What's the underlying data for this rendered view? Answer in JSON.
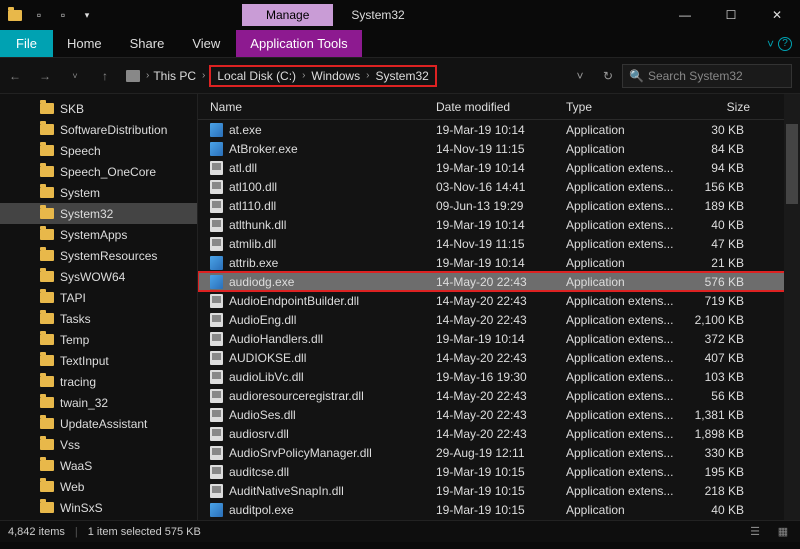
{
  "titlebar": {
    "manage_label": "Manage",
    "title": "System32"
  },
  "ribbon": {
    "file": "File",
    "home": "Home",
    "share": "Share",
    "view": "View",
    "app_tools": "Application Tools"
  },
  "breadcrumb": {
    "thispc": "This PC",
    "localdisk": "Local Disk (C:)",
    "windows": "Windows",
    "system32": "System32"
  },
  "search": {
    "placeholder": "Search System32"
  },
  "tree": {
    "items": [
      {
        "label": "SKB"
      },
      {
        "label": "SoftwareDistribution"
      },
      {
        "label": "Speech"
      },
      {
        "label": "Speech_OneCore"
      },
      {
        "label": "System"
      },
      {
        "label": "System32",
        "sel": true
      },
      {
        "label": "SystemApps"
      },
      {
        "label": "SystemResources"
      },
      {
        "label": "SysWOW64"
      },
      {
        "label": "TAPI"
      },
      {
        "label": "Tasks"
      },
      {
        "label": "Temp"
      },
      {
        "label": "TextInput"
      },
      {
        "label": "tracing"
      },
      {
        "label": "twain_32"
      },
      {
        "label": "UpdateAssistant"
      },
      {
        "label": "Vss"
      },
      {
        "label": "WaaS"
      },
      {
        "label": "Web"
      },
      {
        "label": "WinSxS"
      }
    ]
  },
  "columns": {
    "name": "Name",
    "date": "Date modified",
    "type": "Type",
    "size": "Size"
  },
  "files": [
    {
      "name": "at.exe",
      "date": "19-Mar-19 10:14",
      "type": "Application",
      "size": "30 KB",
      "ic": "exe"
    },
    {
      "name": "AtBroker.exe",
      "date": "14-Nov-19 11:15",
      "type": "Application",
      "size": "84 KB",
      "ic": "exe"
    },
    {
      "name": "atl.dll",
      "date": "19-Mar-19 10:14",
      "type": "Application extens...",
      "size": "94 KB",
      "ic": "dll"
    },
    {
      "name": "atl100.dll",
      "date": "03-Nov-16 14:41",
      "type": "Application extens...",
      "size": "156 KB",
      "ic": "dll"
    },
    {
      "name": "atl110.dll",
      "date": "09-Jun-13 19:29",
      "type": "Application extens...",
      "size": "189 KB",
      "ic": "dll"
    },
    {
      "name": "atlthunk.dll",
      "date": "19-Mar-19 10:14",
      "type": "Application extens...",
      "size": "40 KB",
      "ic": "dll"
    },
    {
      "name": "atmlib.dll",
      "date": "14-Nov-19 11:15",
      "type": "Application extens...",
      "size": "47 KB",
      "ic": "dll"
    },
    {
      "name": "attrib.exe",
      "date": "19-Mar-19 10:14",
      "type": "Application",
      "size": "21 KB",
      "ic": "exe"
    },
    {
      "name": "audiodg.exe",
      "date": "14-May-20 22:43",
      "type": "Application",
      "size": "576 KB",
      "ic": "exe",
      "sel": true
    },
    {
      "name": "AudioEndpointBuilder.dll",
      "date": "14-May-20 22:43",
      "type": "Application extens...",
      "size": "719 KB",
      "ic": "dll"
    },
    {
      "name": "AudioEng.dll",
      "date": "14-May-20 22:43",
      "type": "Application extens...",
      "size": "2,100 KB",
      "ic": "dll"
    },
    {
      "name": "AudioHandlers.dll",
      "date": "19-Mar-19 10:14",
      "type": "Application extens...",
      "size": "372 KB",
      "ic": "dll"
    },
    {
      "name": "AUDIOKSE.dll",
      "date": "14-May-20 22:43",
      "type": "Application extens...",
      "size": "407 KB",
      "ic": "dll"
    },
    {
      "name": "audioLibVc.dll",
      "date": "19-May-16 19:30",
      "type": "Application extens...",
      "size": "103 KB",
      "ic": "dll"
    },
    {
      "name": "audioresourceregistrar.dll",
      "date": "14-May-20 22:43",
      "type": "Application extens...",
      "size": "56 KB",
      "ic": "dll"
    },
    {
      "name": "AudioSes.dll",
      "date": "14-May-20 22:43",
      "type": "Application extens...",
      "size": "1,381 KB",
      "ic": "dll"
    },
    {
      "name": "audiosrv.dll",
      "date": "14-May-20 22:43",
      "type": "Application extens...",
      "size": "1,898 KB",
      "ic": "dll"
    },
    {
      "name": "AudioSrvPolicyManager.dll",
      "date": "29-Aug-19 12:11",
      "type": "Application extens...",
      "size": "330 KB",
      "ic": "dll"
    },
    {
      "name": "auditcse.dll",
      "date": "19-Mar-19 10:15",
      "type": "Application extens...",
      "size": "195 KB",
      "ic": "dll"
    },
    {
      "name": "AuditNativeSnapIn.dll",
      "date": "19-Mar-19 10:15",
      "type": "Application extens...",
      "size": "218 KB",
      "ic": "dll"
    },
    {
      "name": "auditpol.exe",
      "date": "19-Mar-19 10:15",
      "type": "Application",
      "size": "40 KB",
      "ic": "exe"
    }
  ],
  "status": {
    "count": "4,842 items",
    "selection": "1 item selected  575 KB"
  }
}
